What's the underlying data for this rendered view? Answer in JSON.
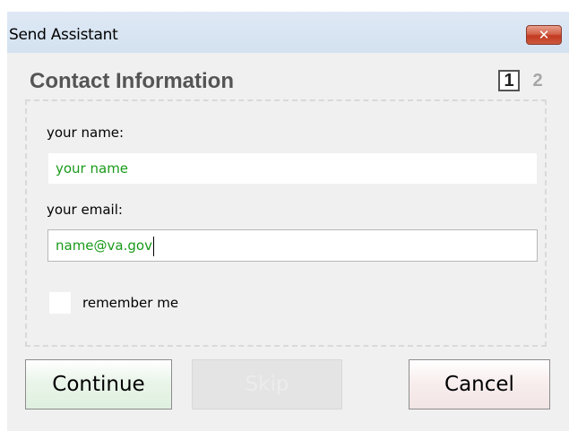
{
  "window": {
    "title": "Send Assistant",
    "close_glyph": "✕"
  },
  "section": {
    "title": "Contact Information",
    "step_current": "1",
    "step_next": "2"
  },
  "form": {
    "name_label": "your name:",
    "name_value": "",
    "name_placeholder": "your name",
    "email_label": "your email:",
    "email_value": "name@va.gov",
    "remember_label": "remember me",
    "remember_checked": false
  },
  "buttons": {
    "continue": "Continue",
    "skip": "Skip",
    "cancel": "Cancel"
  },
  "colors": {
    "input_text": "#1a9a1a",
    "titlebar": "#d3e1f0",
    "close_button": "#c2391f"
  },
  "icons": {
    "close": "close-icon"
  }
}
